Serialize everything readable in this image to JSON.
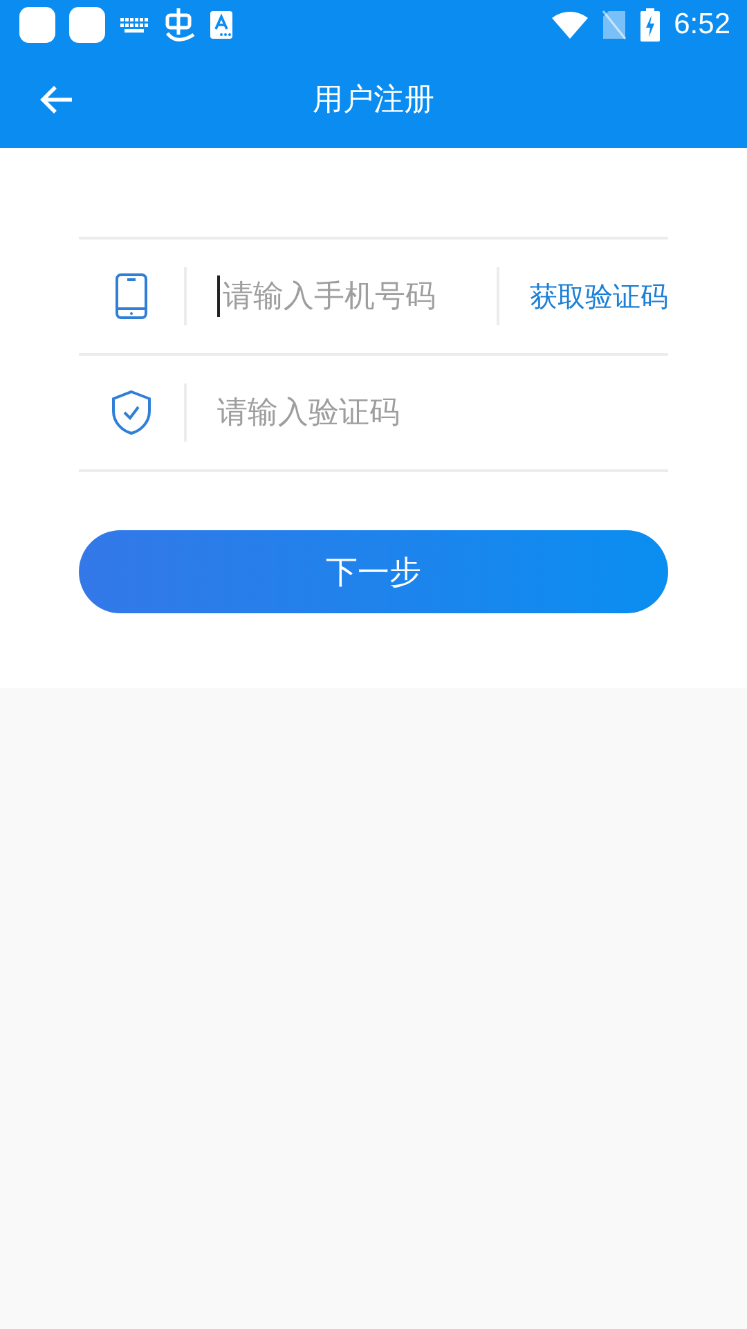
{
  "status_bar": {
    "time": "6:52"
  },
  "app_bar": {
    "title": "用户注册"
  },
  "fields": [
    {
      "kind": "phone",
      "placeholder": "请输入手机号码",
      "focused": true,
      "action": "获取验证码"
    },
    {
      "kind": "code",
      "placeholder": "请输入验证码",
      "focused": false
    }
  ],
  "submit": {
    "label": "下一步"
  }
}
